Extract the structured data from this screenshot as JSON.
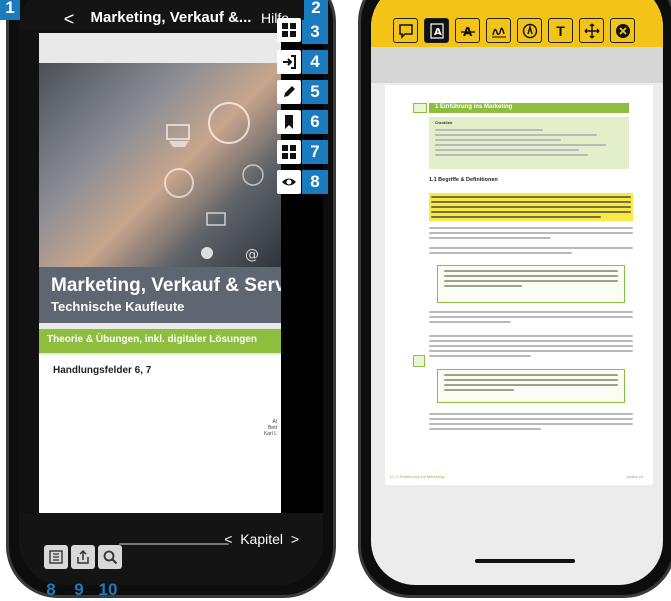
{
  "phone1": {
    "title": "Marketing, Verkauf &...",
    "back_glyph": "<",
    "help_label": "Hilfe",
    "cover": {
      "title": "Marketing, Verkauf & Servic",
      "subtitle": "Technische Kaufleute",
      "green_bar": "Theorie & Übungen, inkl. digitaler Lösungen",
      "handlungsfelder": "Handlungsfelder 6, 7",
      "authors": [
        "Al",
        "Bett",
        "Karl L"
      ]
    },
    "toolbar_icons": [
      "pages-icon",
      "export-icon",
      "pencil-icon",
      "bookmark-icon",
      "grid-icon",
      "eye-icon"
    ],
    "bottom": {
      "kapitel_prefix": "<",
      "kapitel_label": "Kapitel",
      "kapitel_suffix": ">",
      "icons": [
        "list-icon",
        "share-icon",
        "search-icon"
      ]
    },
    "badges": {
      "b1": "1",
      "b2": "2",
      "b3": "3",
      "b4": "4",
      "b5": "5",
      "b6": "6",
      "b7": "7",
      "b8": "8",
      "b8b": "8",
      "b9": "9",
      "b10": "10"
    }
  },
  "phone2": {
    "tools": [
      "comment-icon",
      "text-select-icon",
      "strikethrough-icon",
      "signature-icon",
      "pen-circle-icon",
      "T",
      "move-icon",
      "close-icon"
    ],
    "page": {
      "chapter": "1   Einführung ins Marketing",
      "checklist_title": "Checkliste",
      "section": "1.1     Begriffe & Definitionen",
      "footer_left": "12 | 1  Einführung ins Marketing",
      "footer_right": "strabs.ch"
    }
  },
  "colors": {
    "badge": "#1a7bbf",
    "toolbar_yellow": "#f3c416",
    "accent_green": "#8dbe3d",
    "highlight": "#f7e948"
  }
}
